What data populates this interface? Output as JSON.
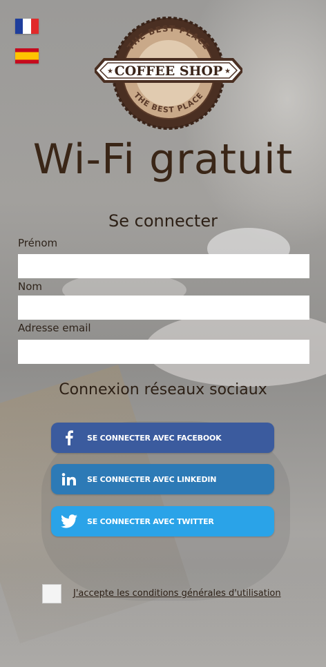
{
  "flags": {
    "french": "France flag",
    "spanish": "Spain flag"
  },
  "logo": {
    "top_text": "THE BEST PLACE",
    "main_text": "COFFEE SHOP",
    "bottom_text": "THE BEST PLACE"
  },
  "title": "Wi-Fi gratuit",
  "login": {
    "heading": "Se connecter",
    "fields": [
      {
        "label": "Prénom",
        "value": "",
        "placeholder": ""
      },
      {
        "label": "Nom",
        "value": "",
        "placeholder": ""
      },
      {
        "label": "Adresse email",
        "value": "",
        "placeholder": ""
      }
    ]
  },
  "social": {
    "heading": "Connexion réseaux sociaux",
    "buttons": [
      {
        "label": "SE CONNECTER AVEC FACEBOOK",
        "icon": "facebook-icon",
        "color": "#3b5b9e"
      },
      {
        "label": "SE CONNECTER AVEC LINKEDIN",
        "icon": "linkedin-icon",
        "color": "#2d7ab6"
      },
      {
        "label": "SE CONNECTER AVEC TWITTER",
        "icon": "twitter-icon",
        "color": "#2aa3e8"
      }
    ]
  },
  "terms": {
    "label": "J'accepte les conditions générales d'utilisation",
    "checked": false
  },
  "colors": {
    "title": "#3a2617",
    "text": "#2d2016"
  }
}
